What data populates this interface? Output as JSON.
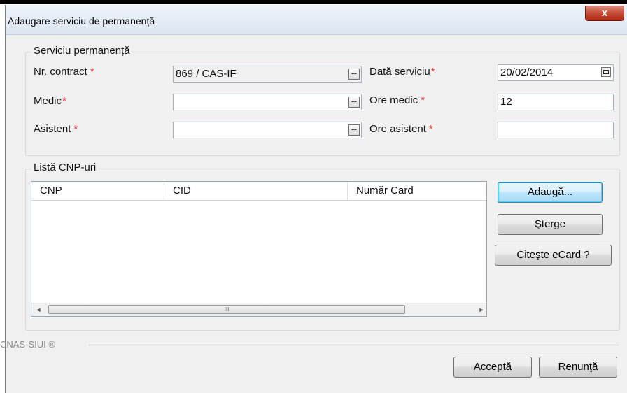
{
  "window": {
    "title": "Adaugare serviciu de permanență",
    "close_glyph": "x"
  },
  "service_group": {
    "title": "Serviciu permanență",
    "contract_label": "Nr. contract",
    "contract_value": "869 / CAS-IF",
    "doctor_label": "Medic",
    "doctor_value": "",
    "assistant_label": "Asistent",
    "assistant_value": "",
    "service_date_label": "Dată serviciu",
    "service_date_value": "20/02/2014",
    "doctor_hours_label": "Ore medic",
    "doctor_hours_value": "12",
    "assistant_hours_label": "Ore asistent",
    "assistant_hours_value": "",
    "required_mark": "*",
    "browse_glyph": "..."
  },
  "cnp_group": {
    "title": "Listă CNP-uri",
    "columns": [
      "CNP",
      "CID",
      "Număr Card"
    ],
    "rows": [],
    "scroll_left": "◄",
    "scroll_right": "►",
    "scroll_grip": "III",
    "add_label": "Adaugă...",
    "delete_label": "Şterge",
    "read_card_label": "Citeşte eCard ?"
  },
  "footer": {
    "brand": "CNAS-SIUI ®",
    "accept_label": "Acceptă",
    "cancel_label": "Renunţă"
  },
  "icons": [
    "close-icon",
    "ellipsis-icon",
    "calendar-icon",
    "scroll-left-icon",
    "scroll-right-icon"
  ],
  "colors": {
    "required": "#e3312a",
    "close_button": "#c44a35",
    "default_button": "#3c7fb1"
  }
}
